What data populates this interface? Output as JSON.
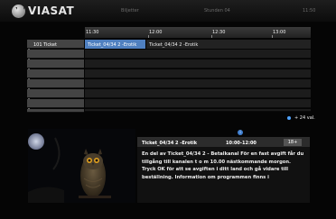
{
  "header": {
    "brand": "VIASAT",
    "left_label": "Biljetter",
    "center_label": "Stunden 04",
    "clock": "11:50"
  },
  "guide": {
    "times": [
      "11:30",
      "12:00",
      "12:30",
      "13:00"
    ],
    "rows": [
      {
        "channel": "101 Ticket",
        "programs": [
          {
            "title": "Ticket_04/34 2 -Erotik",
            "selected": true
          },
          {
            "title": "Ticket_04/34 2 -Erotik",
            "selected": false
          }
        ]
      },
      {
        "channel": "",
        "programs": []
      },
      {
        "channel": "",
        "programs": []
      },
      {
        "channel": "",
        "programs": []
      },
      {
        "channel": "",
        "programs": []
      },
      {
        "channel": "",
        "programs": []
      },
      {
        "channel": "",
        "programs": []
      },
      {
        "channel": "",
        "programs": []
      }
    ],
    "more_label": "+ 24 val."
  },
  "info": {
    "icon": "info-icon",
    "title": "Ticket_04/34 2 -Erotik",
    "time": "10:00-12:00",
    "age": "18+",
    "description": "En del av Ticket_04/34 2 - Betalkanal För en fast avgift får du tillgång till kanalen t o m 10.00 nästkommande morgon. Tryck OK för att se avgiften i ditt land och gå vidare till beställning. Information om programmen finns i"
  }
}
